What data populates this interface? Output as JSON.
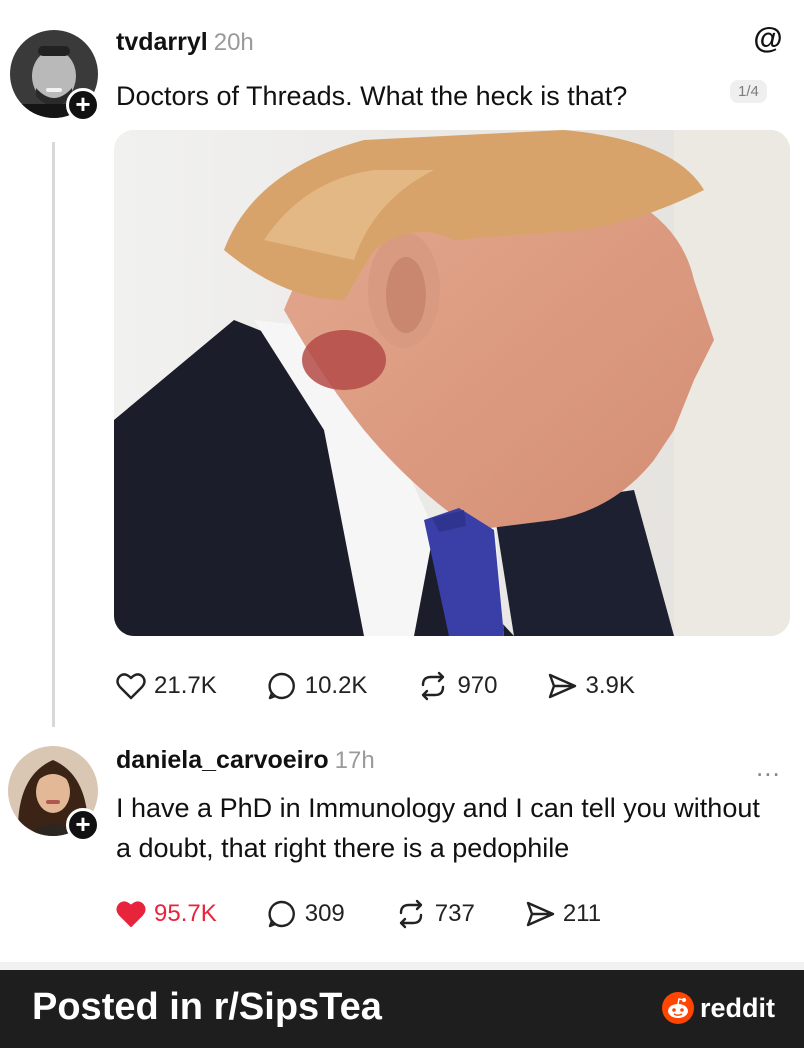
{
  "post": {
    "username": "tvdarryl",
    "time": "20h",
    "text": "Doctors of Threads. What the heck is that?",
    "image_counter": "1/4",
    "follow_badge": "+",
    "likes": "21.7K",
    "replies": "10.2K",
    "reposts": "970",
    "shares": "3.9K"
  },
  "reply": {
    "username": "daniela_carvoeiro",
    "time": "17h",
    "text": "I have a PhD in Immunology and I can tell you without a doubt, that right there is a pedophile",
    "follow_badge": "+",
    "likes": "95.7K",
    "replies": "309",
    "reposts": "737",
    "shares": "211",
    "more": "..."
  },
  "footer": {
    "text": "Posted in r/SipsTea",
    "brand": "reddit"
  },
  "icons": {
    "app": "threads-logo-icon",
    "like": "heart-icon",
    "reply": "comment-bubble-icon",
    "repost": "repost-icon",
    "share": "share-icon",
    "brand": "reddit-alien-icon"
  },
  "colors": {
    "liked_heart": "#e8243c",
    "footer_bg": "#1e1e1e",
    "reddit_orange": "#ff4500"
  }
}
